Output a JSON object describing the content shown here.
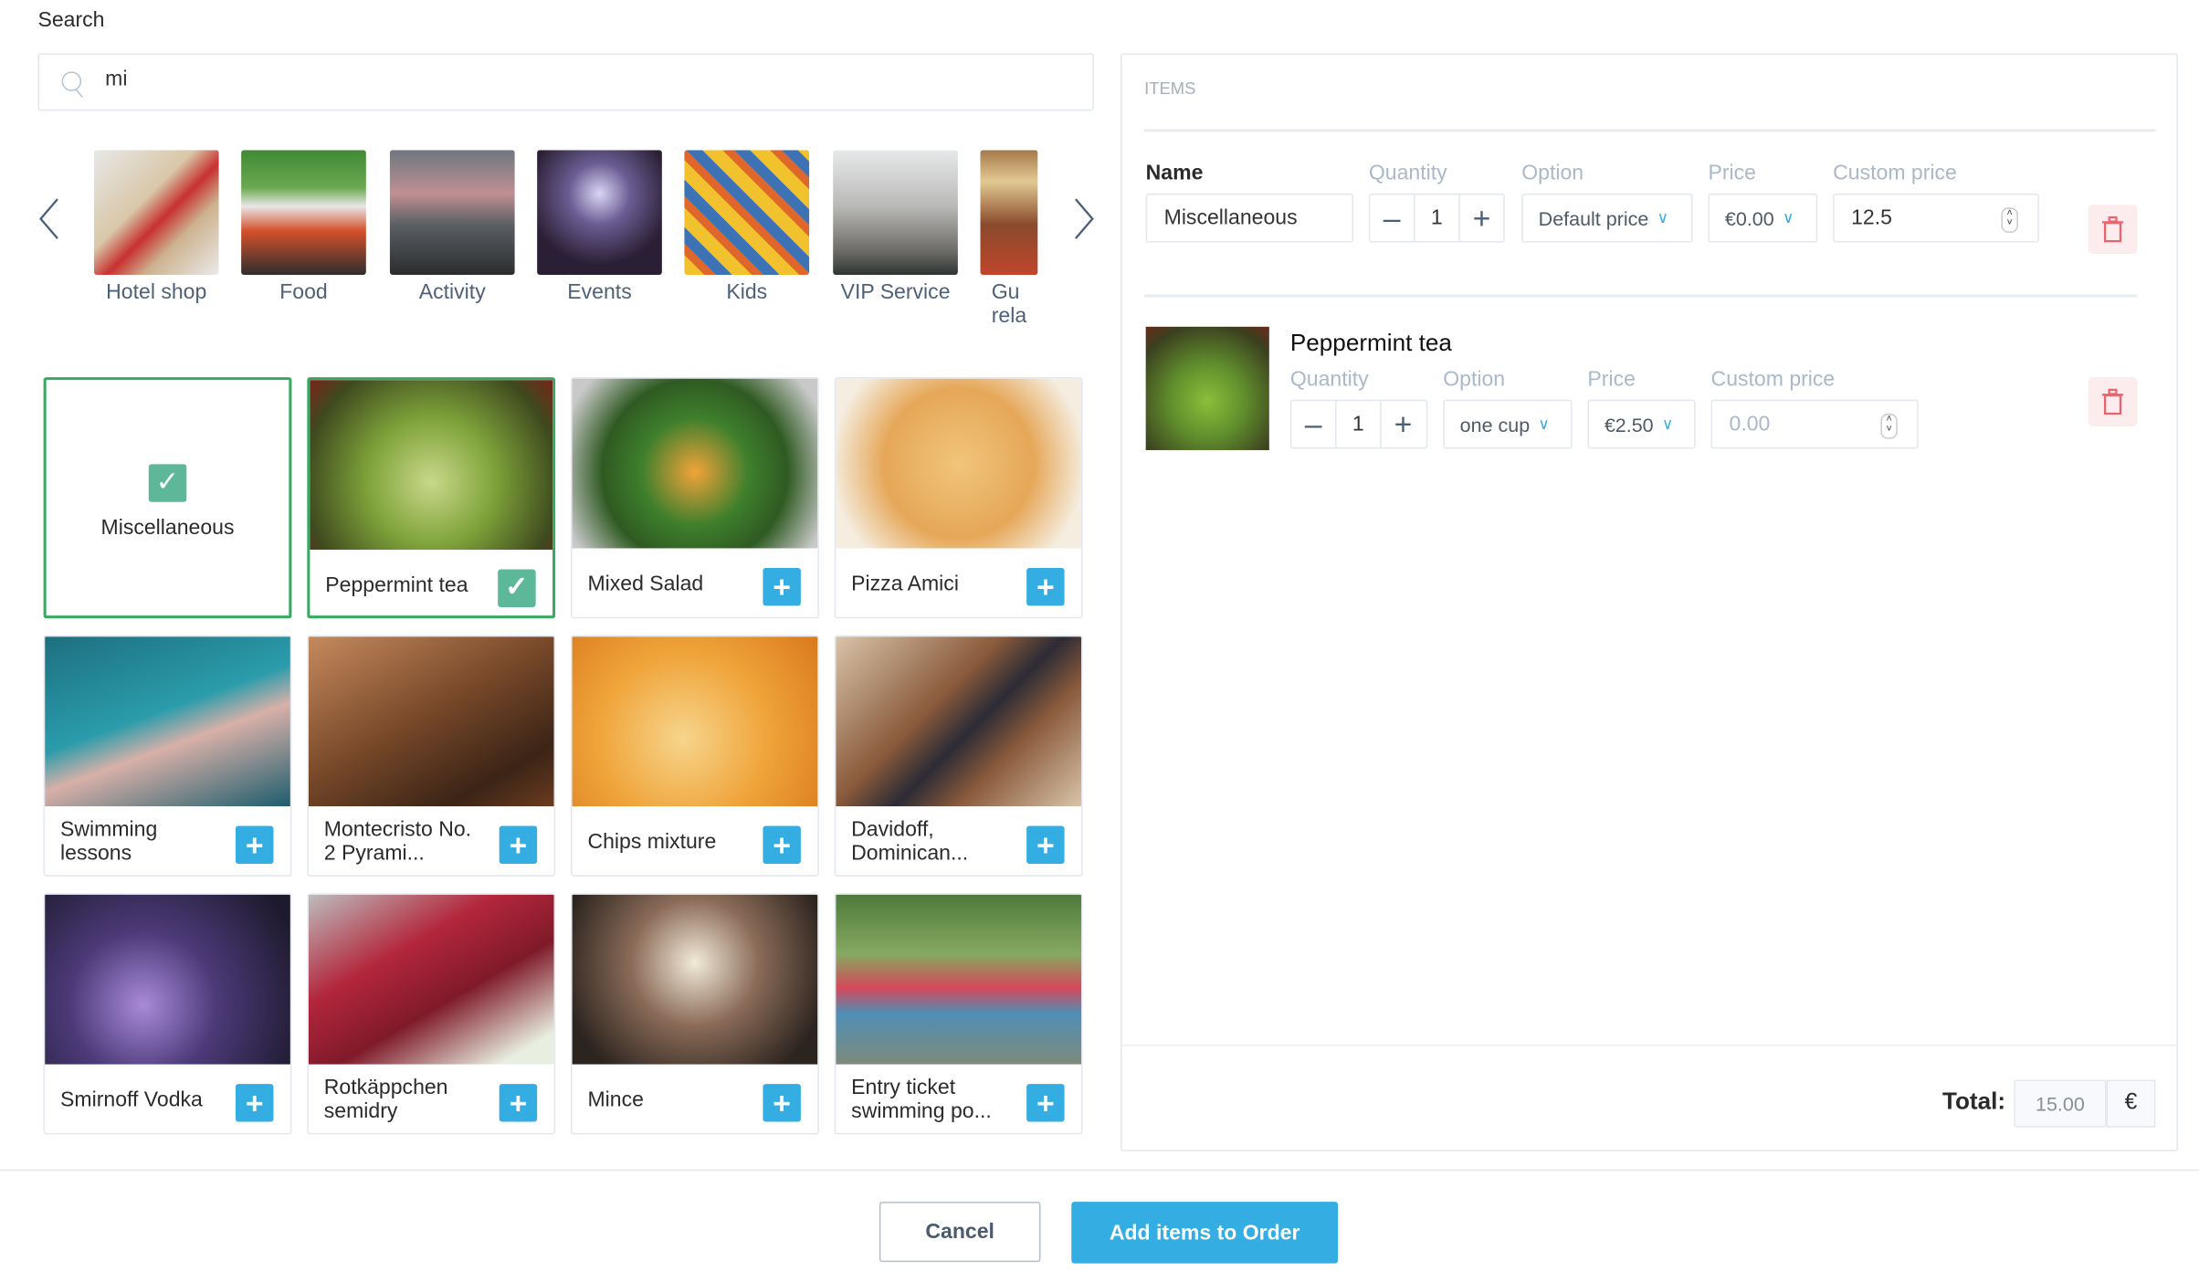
{
  "search": {
    "label": "Search",
    "value": "mi",
    "icon": "search-icon"
  },
  "categories": [
    {
      "label": "Hotel shop"
    },
    {
      "label": "Food"
    },
    {
      "label": "Activity"
    },
    {
      "label": "Events"
    },
    {
      "label": "Kids"
    },
    {
      "label": "VIP Service"
    },
    {
      "label": "Gu\nrela"
    }
  ],
  "products": [
    {
      "name": "Miscellaneous",
      "selected": true
    },
    {
      "name": "Peppermint tea",
      "selected": true
    },
    {
      "name": "Mixed Salad",
      "selected": false
    },
    {
      "name": "Pizza Amici",
      "selected": false
    },
    {
      "name": "Swimming lessons",
      "selected": false
    },
    {
      "name": "Montecristo No. 2 Pyrami...",
      "selected": false
    },
    {
      "name": "Chips mixture",
      "selected": false
    },
    {
      "name": "Davidoff, Dominican...",
      "selected": false
    },
    {
      "name": "Smirnoff Vodka",
      "selected": false
    },
    {
      "name": "Rotkäppchen semidry",
      "selected": false
    },
    {
      "name": "Mince",
      "selected": false
    },
    {
      "name": "Entry ticket swimming po...",
      "selected": false
    }
  ],
  "items_panel": {
    "title": "ITEMS",
    "headers": {
      "name": "Name",
      "quantity": "Quantity",
      "option": "Option",
      "price": "Price",
      "custom_price": "Custom price"
    },
    "rows": [
      {
        "name": "Miscellaneous",
        "quantity": "1",
        "option": "Default price",
        "price": "€0.00",
        "custom_price": "12.5",
        "custom_price_placeholder": ""
      },
      {
        "name": "Peppermint tea",
        "quantity": "1",
        "option": "one cup",
        "price": "€2.50",
        "custom_price": "",
        "custom_price_placeholder": "0.00"
      }
    ],
    "total_label": "Total:",
    "total_value": "15.00",
    "currency": "€"
  },
  "footer": {
    "cancel_label": "Cancel",
    "add_label": "Add items to Order"
  },
  "colors": {
    "accent": "#33ade2",
    "selected_border": "#3aa862",
    "check": "#5db89a",
    "danger": "#e8656f"
  }
}
